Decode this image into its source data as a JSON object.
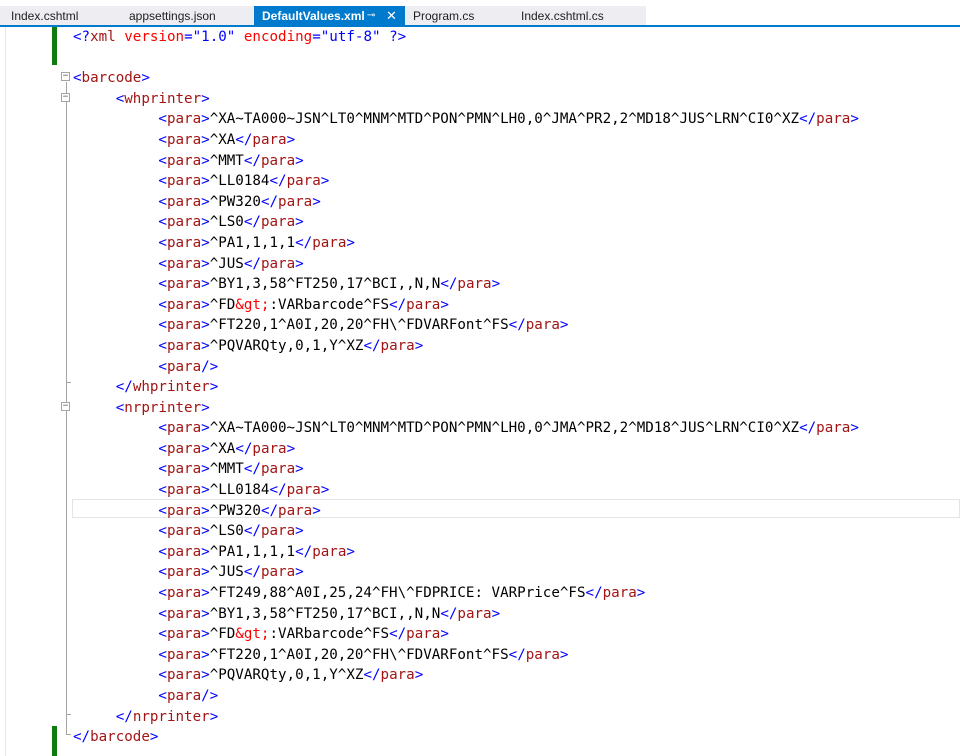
{
  "tabs": [
    {
      "label": "Index.cshtml",
      "active": false
    },
    {
      "label": "appsettings.json",
      "active": false
    },
    {
      "label": "DefaultValues.xml",
      "active": true
    },
    {
      "label": "Program.cs",
      "active": false
    },
    {
      "label": "Index.cshtml.cs",
      "active": false
    }
  ],
  "active_tab": {
    "pin_glyph": "⊸",
    "close_glyph": "✕"
  },
  "colors": {
    "accent": "#007acc",
    "change_bar": "#107c10",
    "xml_tag": "#a31515",
    "xml_delim": "#0000ff",
    "xml_attr": "#ff0000"
  },
  "editor": {
    "lines": [
      [
        {
          "d": "<?"
        },
        {
          "g": "xml"
        },
        {
          "a": " version"
        },
        {
          "d": "="
        },
        {
          "v": "\"1.0\""
        },
        {
          "a": " encoding"
        },
        {
          "d": "="
        },
        {
          "v": "\"utf-8\""
        },
        {
          "d": " ?>"
        }
      ],
      [],
      [
        {
          "d": "<"
        },
        {
          "g": "barcode"
        },
        {
          "d": ">"
        }
      ],
      [
        {
          "x": "     "
        },
        {
          "d": "<"
        },
        {
          "g": "whprinter"
        },
        {
          "d": ">"
        }
      ],
      [
        {
          "x": "          "
        },
        {
          "d": "<"
        },
        {
          "g": "para"
        },
        {
          "d": ">"
        },
        {
          "x": "^XA~TA000~JSN^LT0^MNM^MTD^PON^PMN^LH0,0^JMA^PR2,2^MD18^JUS^LRN^CI0^XZ"
        },
        {
          "d": "</"
        },
        {
          "g": "para"
        },
        {
          "d": ">"
        }
      ],
      [
        {
          "x": "          "
        },
        {
          "d": "<"
        },
        {
          "g": "para"
        },
        {
          "d": ">"
        },
        {
          "x": "^XA"
        },
        {
          "d": "</"
        },
        {
          "g": "para"
        },
        {
          "d": ">"
        }
      ],
      [
        {
          "x": "          "
        },
        {
          "d": "<"
        },
        {
          "g": "para"
        },
        {
          "d": ">"
        },
        {
          "x": "^MMT"
        },
        {
          "d": "</"
        },
        {
          "g": "para"
        },
        {
          "d": ">"
        }
      ],
      [
        {
          "x": "          "
        },
        {
          "d": "<"
        },
        {
          "g": "para"
        },
        {
          "d": ">"
        },
        {
          "x": "^LL0184"
        },
        {
          "d": "</"
        },
        {
          "g": "para"
        },
        {
          "d": ">"
        }
      ],
      [
        {
          "x": "          "
        },
        {
          "d": "<"
        },
        {
          "g": "para"
        },
        {
          "d": ">"
        },
        {
          "x": "^PW320"
        },
        {
          "d": "</"
        },
        {
          "g": "para"
        },
        {
          "d": ">"
        }
      ],
      [
        {
          "x": "          "
        },
        {
          "d": "<"
        },
        {
          "g": "para"
        },
        {
          "d": ">"
        },
        {
          "x": "^LS0"
        },
        {
          "d": "</"
        },
        {
          "g": "para"
        },
        {
          "d": ">"
        }
      ],
      [
        {
          "x": "          "
        },
        {
          "d": "<"
        },
        {
          "g": "para"
        },
        {
          "d": ">"
        },
        {
          "x": "^PA1,1,1,1"
        },
        {
          "d": "</"
        },
        {
          "g": "para"
        },
        {
          "d": ">"
        }
      ],
      [
        {
          "x": "          "
        },
        {
          "d": "<"
        },
        {
          "g": "para"
        },
        {
          "d": ">"
        },
        {
          "x": "^JUS"
        },
        {
          "d": "</"
        },
        {
          "g": "para"
        },
        {
          "d": ">"
        }
      ],
      [
        {
          "x": "          "
        },
        {
          "d": "<"
        },
        {
          "g": "para"
        },
        {
          "d": ">"
        },
        {
          "x": "^BY1,3,58^FT250,17^BCI,,N,N"
        },
        {
          "d": "</"
        },
        {
          "g": "para"
        },
        {
          "d": ">"
        }
      ],
      [
        {
          "x": "          "
        },
        {
          "d": "<"
        },
        {
          "g": "para"
        },
        {
          "d": ">"
        },
        {
          "x": "^FD"
        },
        {
          "a": "&gt;"
        },
        {
          "x": ":VARbarcode^FS"
        },
        {
          "d": "</"
        },
        {
          "g": "para"
        },
        {
          "d": ">"
        }
      ],
      [
        {
          "x": "          "
        },
        {
          "d": "<"
        },
        {
          "g": "para"
        },
        {
          "d": ">"
        },
        {
          "x": "^FT220,1^A0I,20,20^FH\\^FDVARFont^FS"
        },
        {
          "d": "</"
        },
        {
          "g": "para"
        },
        {
          "d": ">"
        }
      ],
      [
        {
          "x": "          "
        },
        {
          "d": "<"
        },
        {
          "g": "para"
        },
        {
          "d": ">"
        },
        {
          "x": "^PQVARQty,0,1,Y^XZ"
        },
        {
          "d": "</"
        },
        {
          "g": "para"
        },
        {
          "d": ">"
        }
      ],
      [
        {
          "x": "          "
        },
        {
          "d": "<"
        },
        {
          "g": "para"
        },
        {
          "d": "/>"
        }
      ],
      [
        {
          "x": "     "
        },
        {
          "d": "</"
        },
        {
          "g": "whprinter"
        },
        {
          "d": ">"
        }
      ],
      [
        {
          "x": "     "
        },
        {
          "d": "<"
        },
        {
          "g": "nrprinter"
        },
        {
          "d": ">"
        }
      ],
      [
        {
          "x": "          "
        },
        {
          "d": "<"
        },
        {
          "g": "para"
        },
        {
          "d": ">"
        },
        {
          "x": "^XA~TA000~JSN^LT0^MNM^MTD^PON^PMN^LH0,0^JMA^PR2,2^MD18^JUS^LRN^CI0^XZ"
        },
        {
          "d": "</"
        },
        {
          "g": "para"
        },
        {
          "d": ">"
        }
      ],
      [
        {
          "x": "          "
        },
        {
          "d": "<"
        },
        {
          "g": "para"
        },
        {
          "d": ">"
        },
        {
          "x": "^XA"
        },
        {
          "d": "</"
        },
        {
          "g": "para"
        },
        {
          "d": ">"
        }
      ],
      [
        {
          "x": "          "
        },
        {
          "d": "<"
        },
        {
          "g": "para"
        },
        {
          "d": ">"
        },
        {
          "x": "^MMT"
        },
        {
          "d": "</"
        },
        {
          "g": "para"
        },
        {
          "d": ">"
        }
      ],
      [
        {
          "x": "          "
        },
        {
          "d": "<"
        },
        {
          "g": "para"
        },
        {
          "d": ">"
        },
        {
          "x": "^LL0184"
        },
        {
          "d": "</"
        },
        {
          "g": "para"
        },
        {
          "d": ">"
        }
      ],
      [
        {
          "x": "          "
        },
        {
          "d": "<"
        },
        {
          "g": "para"
        },
        {
          "d": ">"
        },
        {
          "x": "^PW320"
        },
        {
          "d": "</"
        },
        {
          "g": "para"
        },
        {
          "d": ">"
        }
      ],
      [
        {
          "x": "          "
        },
        {
          "d": "<"
        },
        {
          "g": "para"
        },
        {
          "d": ">"
        },
        {
          "x": "^LS0"
        },
        {
          "d": "</"
        },
        {
          "g": "para"
        },
        {
          "d": ">"
        }
      ],
      [
        {
          "x": "          "
        },
        {
          "d": "<"
        },
        {
          "g": "para"
        },
        {
          "d": ">"
        },
        {
          "x": "^PA1,1,1,1"
        },
        {
          "d": "</"
        },
        {
          "g": "para"
        },
        {
          "d": ">"
        }
      ],
      [
        {
          "x": "          "
        },
        {
          "d": "<"
        },
        {
          "g": "para"
        },
        {
          "d": ">"
        },
        {
          "x": "^JUS"
        },
        {
          "d": "</"
        },
        {
          "g": "para"
        },
        {
          "d": ">"
        }
      ],
      [
        {
          "x": "          "
        },
        {
          "d": "<"
        },
        {
          "g": "para"
        },
        {
          "d": ">"
        },
        {
          "x": "^FT249,88^A0I,25,24^FH\\^FDPRICE: VARPrice^FS"
        },
        {
          "d": "</"
        },
        {
          "g": "para"
        },
        {
          "d": ">"
        }
      ],
      [
        {
          "x": "          "
        },
        {
          "d": "<"
        },
        {
          "g": "para"
        },
        {
          "d": ">"
        },
        {
          "x": "^BY1,3,58^FT250,17^BCI,,N,N"
        },
        {
          "d": "</"
        },
        {
          "g": "para"
        },
        {
          "d": ">"
        }
      ],
      [
        {
          "x": "          "
        },
        {
          "d": "<"
        },
        {
          "g": "para"
        },
        {
          "d": ">"
        },
        {
          "x": "^FD"
        },
        {
          "a": "&gt;"
        },
        {
          "x": ":VARbarcode^FS"
        },
        {
          "d": "</"
        },
        {
          "g": "para"
        },
        {
          "d": ">"
        }
      ],
      [
        {
          "x": "          "
        },
        {
          "d": "<"
        },
        {
          "g": "para"
        },
        {
          "d": ">"
        },
        {
          "x": "^FT220,1^A0I,20,20^FH\\^FDVARFont^FS"
        },
        {
          "d": "</"
        },
        {
          "g": "para"
        },
        {
          "d": ">"
        }
      ],
      [
        {
          "x": "          "
        },
        {
          "d": "<"
        },
        {
          "g": "para"
        },
        {
          "d": ">"
        },
        {
          "x": "^PQVARQty,0,1,Y^XZ"
        },
        {
          "d": "</"
        },
        {
          "g": "para"
        },
        {
          "d": ">"
        }
      ],
      [
        {
          "x": "          "
        },
        {
          "d": "<"
        },
        {
          "g": "para"
        },
        {
          "d": "/>"
        }
      ],
      [
        {
          "x": "     "
        },
        {
          "d": "</"
        },
        {
          "g": "nrprinter"
        },
        {
          "d": ">"
        }
      ],
      [
        {
          "d": "</"
        },
        {
          "g": "barcode"
        },
        {
          "d": ">"
        }
      ]
    ]
  }
}
